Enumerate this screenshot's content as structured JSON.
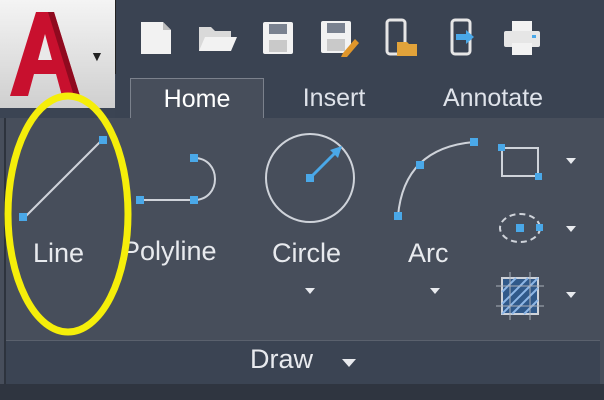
{
  "ribbon": {
    "tabs": [
      {
        "label": "Home",
        "active": true
      },
      {
        "label": "Insert",
        "active": false
      },
      {
        "label": "Annotate",
        "active": false
      }
    ]
  },
  "qat": {
    "icons": [
      "new-icon",
      "open-icon",
      "save-icon",
      "save-as-icon",
      "open-from-web-icon",
      "share-icon",
      "plot-icon"
    ]
  },
  "draw_panel": {
    "title": "Draw",
    "tools": {
      "line": "Line",
      "polyline": "Polyline",
      "circle": "Circle",
      "arc": "Arc"
    }
  },
  "annotation": {
    "color": "#f5ee0a",
    "target": "Line"
  },
  "colors": {
    "brand_red": "#c8102e",
    "accent_blue": "#4aa8e8",
    "panel_bg": "#474e5b"
  }
}
